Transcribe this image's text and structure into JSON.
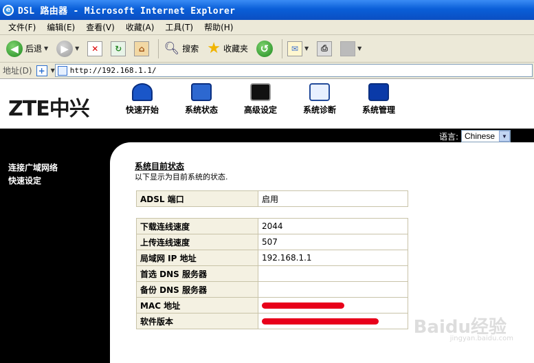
{
  "window": {
    "title": "DSL 路由器 - Microsoft Internet Explorer"
  },
  "menu": [
    "文件(F)",
    "编辑(E)",
    "查看(V)",
    "收藏(A)",
    "工具(T)",
    "帮助(H)"
  ],
  "toolbar": {
    "back_label": "后退",
    "search_label": "搜索",
    "favorites_label": "收藏夹"
  },
  "address": {
    "label": "地址(D)",
    "url": "http://192.168.1.1/"
  },
  "header": {
    "logo": "ZTE中兴",
    "nav": [
      "快速开始",
      "系统状态",
      "高级设定",
      "系统诊断",
      "系统管理"
    ],
    "language_label": "语言:",
    "language_value": "Chinese"
  },
  "sidebar": [
    "连接广域网络",
    "快速设定"
  ],
  "content": {
    "heading": "系统目前状态",
    "description": "以下显示为目前系统的状态.",
    "adsl": {
      "key": "ADSL 端口",
      "value": "启用"
    },
    "rows": [
      {
        "key": "下载连线速度",
        "value": "2044"
      },
      {
        "key": "上传连线速度",
        "value": "507"
      },
      {
        "key": "局域网 IP 地址",
        "value": "192.168.1.1"
      },
      {
        "key": "首选 DNS 服务器",
        "value": ""
      },
      {
        "key": "备份 DNS 服务器",
        "value": ""
      },
      {
        "key": "MAC 地址",
        "value": ""
      },
      {
        "key": "软件版本",
        "value": ""
      }
    ]
  },
  "watermark": {
    "main": "Baidu经验",
    "sub": "jingyan.baidu.com"
  }
}
